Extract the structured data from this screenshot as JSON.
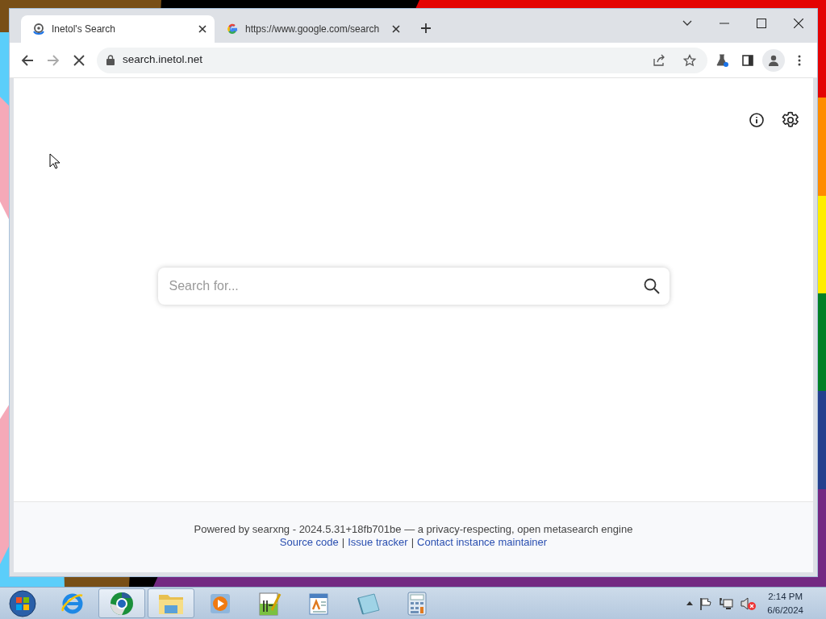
{
  "browser": {
    "tabs": [
      {
        "title": "Inetol's Search",
        "selected": true
      },
      {
        "title": "https://www.google.com/search",
        "selected": false
      }
    ],
    "address": "search.inetol.net",
    "loading": true
  },
  "page": {
    "search": {
      "placeholder": "Search for..."
    },
    "footer": {
      "powered": "Powered by searxng - 2024.5.31+18fb701be — a privacy-respecting, open metasearch engine",
      "links": [
        "Source code",
        "Issue tracker",
        "Contact instance maintainer"
      ],
      "separators": [
        "|",
        "|"
      ]
    }
  },
  "taskbar": {
    "apps": [
      {
        "kind": "ie",
        "selected": false
      },
      {
        "kind": "chrome",
        "selected": true
      },
      {
        "kind": "folder",
        "selected": true
      },
      {
        "kind": "media",
        "selected": false
      },
      {
        "kind": "notepadpp",
        "selected": false
      },
      {
        "kind": "wordpad",
        "selected": false
      },
      {
        "kind": "notepad",
        "selected": false
      },
      {
        "kind": "calculator",
        "selected": false
      }
    ],
    "clock": {
      "time": "2:14 PM",
      "date": "6/6/2024"
    }
  }
}
